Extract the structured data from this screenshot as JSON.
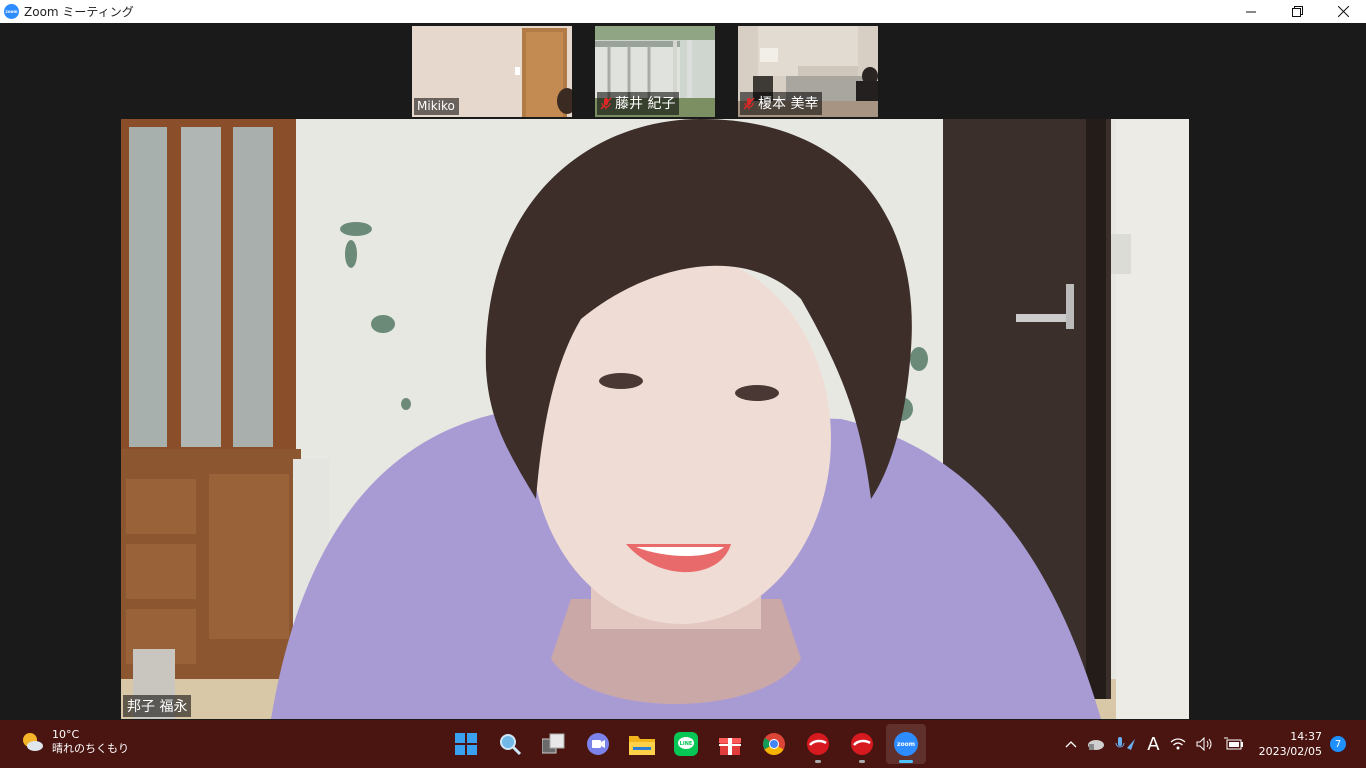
{
  "window": {
    "title": "Zoom ミーティング",
    "app_icon_text": "zoom"
  },
  "participants": [
    {
      "name": "Mikiko",
      "muted": false
    },
    {
      "name": "藤井 紀子",
      "muted": true
    },
    {
      "name": "榎本 美幸",
      "muted": true
    }
  ],
  "active_speaker": {
    "name": "邦子 福永"
  },
  "taskbar": {
    "weather": {
      "temp": "10°C",
      "desc": "晴れのちくもり"
    },
    "apps": [
      {
        "icon": "windows-start-icon",
        "active": false,
        "running": false
      },
      {
        "icon": "search-icon",
        "active": false,
        "running": false
      },
      {
        "icon": "task-view-icon",
        "active": false,
        "running": false
      },
      {
        "icon": "chat-icon",
        "active": false,
        "running": false
      },
      {
        "icon": "file-explorer-icon",
        "active": false,
        "running": false
      },
      {
        "icon": "line-icon",
        "active": false,
        "running": false
      },
      {
        "icon": "gift-icon",
        "active": false,
        "running": false
      },
      {
        "icon": "chrome-icon",
        "active": false,
        "running": false
      },
      {
        "icon": "trend-micro-icon",
        "active": false,
        "running": true
      },
      {
        "icon": "trend-micro-icon",
        "active": false,
        "running": true
      },
      {
        "icon": "zoom-icon",
        "active": true,
        "running": true
      }
    ],
    "tray": {
      "ime": "A"
    },
    "clock": {
      "time": "14:37",
      "date": "2023/02/05"
    },
    "notifications": "7"
  },
  "colors": {
    "taskbar": "#4a1410",
    "zoom_blue": "#2d8cff",
    "mute_red": "#e02828"
  }
}
